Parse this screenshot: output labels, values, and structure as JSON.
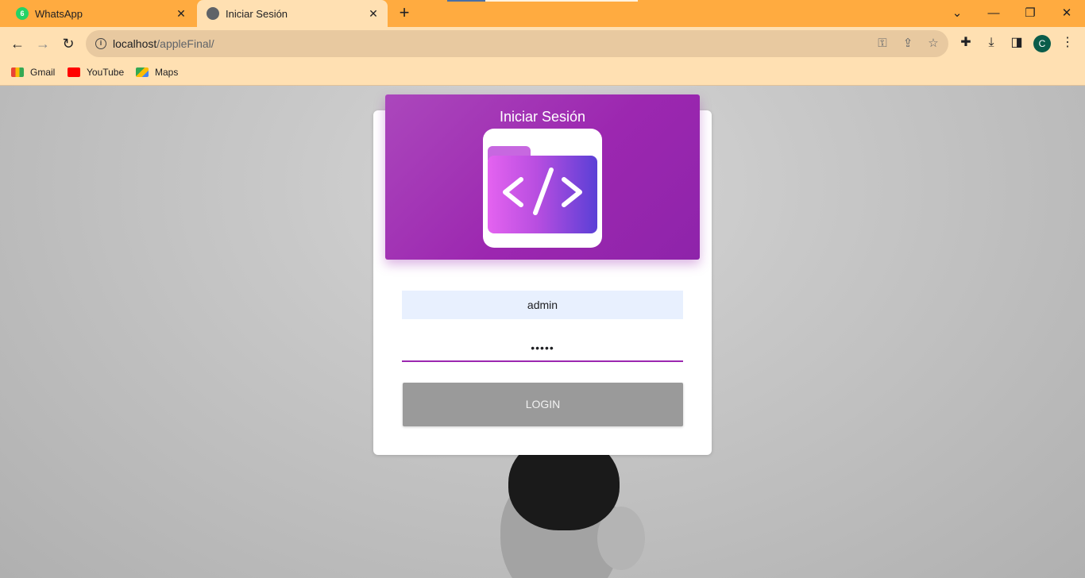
{
  "browser": {
    "tabs": [
      {
        "title": "WhatsApp",
        "favicon_badge": "6",
        "favicon": "whatsapp-icon"
      },
      {
        "title": "Iniciar Sesión",
        "favicon": "globe-icon",
        "active": true
      }
    ],
    "address": {
      "host": "localhost",
      "path": "/appleFinal/"
    },
    "bookmarks": [
      {
        "label": "Gmail",
        "icon": "gmail-icon"
      },
      {
        "label": "YouTube",
        "icon": "youtube-icon"
      },
      {
        "label": "Maps",
        "icon": "maps-icon"
      }
    ],
    "profile_initial": "C"
  },
  "login": {
    "title": "Iniciar Sesión",
    "username_value": "admin",
    "password_value": "•••••",
    "button_label": "LOGIN"
  },
  "colors": {
    "header_purple": "#9c27b0",
    "tabstrip": "#ffab40",
    "toolbar": "#ffe0b2",
    "button_gray": "#9a9a9a",
    "input_fill": "#e8f0fe"
  }
}
